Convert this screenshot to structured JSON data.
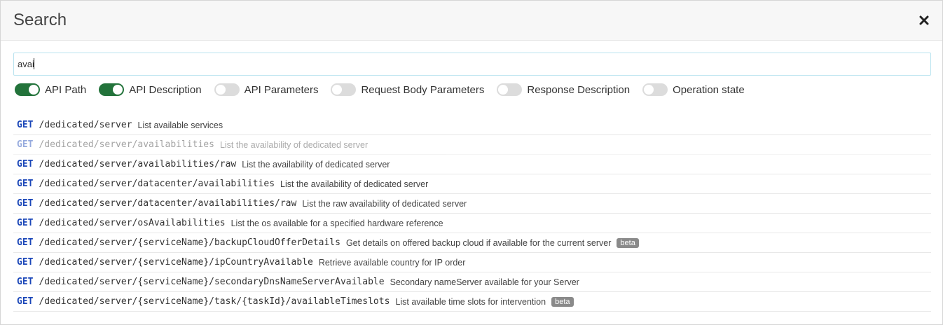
{
  "modal": {
    "title": "Search"
  },
  "search": {
    "value": "avai"
  },
  "toggles": [
    {
      "label": "API Path",
      "on": true
    },
    {
      "label": "API Description",
      "on": true
    },
    {
      "label": "API Parameters",
      "on": false
    },
    {
      "label": "Request Body Parameters",
      "on": false
    },
    {
      "label": "Response Description",
      "on": false
    },
    {
      "label": "Operation state",
      "on": false
    }
  ],
  "results": [
    {
      "method": "GET",
      "path": "/dedicated/server",
      "desc": "List available services",
      "badge": ""
    },
    {
      "method": "GET",
      "path": "/dedicated/server/availabilities",
      "desc": "List the availability of dedicated server",
      "badge": "",
      "muted": true
    },
    {
      "method": "GET",
      "path": "/dedicated/server/availabilities/raw",
      "desc": "List the availability of dedicated server",
      "badge": ""
    },
    {
      "method": "GET",
      "path": "/dedicated/server/datacenter/availabilities",
      "desc": "List the availability of dedicated server",
      "badge": ""
    },
    {
      "method": "GET",
      "path": "/dedicated/server/datacenter/availabilities/raw",
      "desc": "List the raw availability of dedicated server",
      "badge": ""
    },
    {
      "method": "GET",
      "path": "/dedicated/server/osAvailabilities",
      "desc": "List the os available for a specified hardware reference",
      "badge": ""
    },
    {
      "method": "GET",
      "path": "/dedicated/server/{serviceName}/backupCloudOfferDetails",
      "desc": "Get details on offered backup cloud if available for the current server",
      "badge": "beta"
    },
    {
      "method": "GET",
      "path": "/dedicated/server/{serviceName}/ipCountryAvailable",
      "desc": "Retrieve available country for IP order",
      "badge": ""
    },
    {
      "method": "GET",
      "path": "/dedicated/server/{serviceName}/secondaryDnsNameServerAvailable",
      "desc": "Secondary nameServer available for your Server",
      "badge": ""
    },
    {
      "method": "GET",
      "path": "/dedicated/server/{serviceName}/task/{taskId}/availableTimeslots",
      "desc": "List available time slots for intervention",
      "badge": "beta"
    }
  ],
  "colors": {
    "method": "#1a46b8",
    "toggle_on": "#23733b",
    "toggle_off": "#dcdcdc",
    "input_border": "#b9e3ef"
  },
  "icons": {
    "close": "close-icon"
  }
}
